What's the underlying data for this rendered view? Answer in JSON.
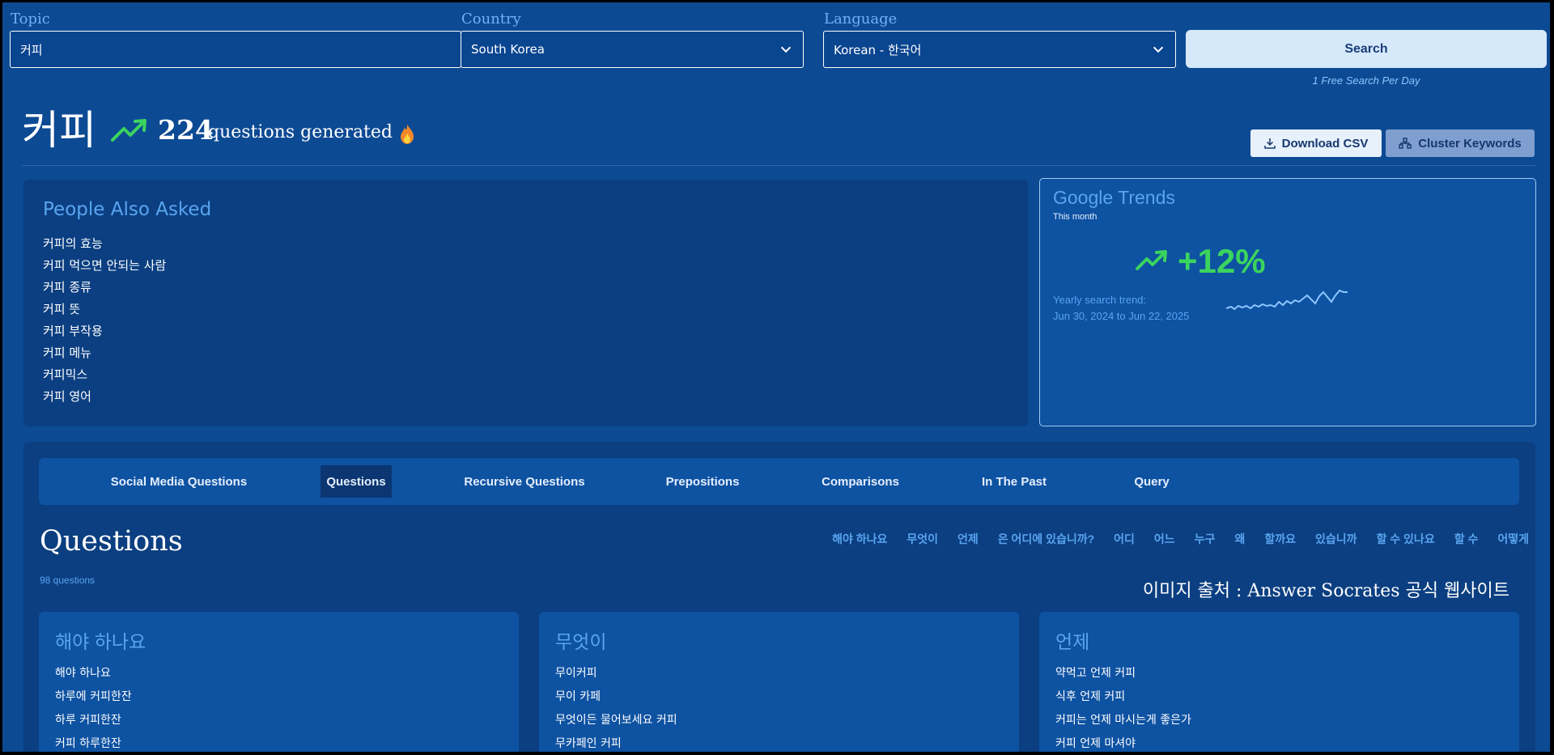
{
  "search": {
    "topic_label": "Topic",
    "topic_value": "커피",
    "country_label": "Country",
    "country_value": "South Korea",
    "language_label": "Language",
    "language_value": "Korean - 한국어",
    "search_button": "Search",
    "free_note": "1 Free Search Per Day"
  },
  "header": {
    "topic": "커피",
    "count": "224",
    "generated_text": "questions generated",
    "download_csv": "Download CSV",
    "cluster_keywords": "Cluster Keywords"
  },
  "paa": {
    "title": "People Also Asked",
    "items": [
      "커피의 효능",
      "커피 먹으면 안되는 사람",
      "커피 종류",
      "커피 뜻",
      "커피 부작용",
      "커피 메뉴",
      "커피믹스",
      "커피 영어"
    ]
  },
  "trends": {
    "title": "Google Trends",
    "subtitle": "This month",
    "percent": "+12%",
    "yearly_label": "Yearly search trend:",
    "range": "Jun 30, 2024 to Jun 22, 2025",
    "accent": "#3bd45e"
  },
  "tabs": [
    {
      "label": "Social Media Questions"
    },
    {
      "label": "Questions"
    },
    {
      "label": "Recursive Questions"
    },
    {
      "label": "Prepositions"
    },
    {
      "label": "Comparisons"
    },
    {
      "label": "In The Past"
    },
    {
      "label": "Query"
    }
  ],
  "questions": {
    "heading": "Questions",
    "count": "98 questions",
    "filters": [
      "해야 하나요",
      "무엇이",
      "언제",
      "은 어디에 있습니까?",
      "어디",
      "어느",
      "누구",
      "왜",
      "할까요",
      "있습니까",
      "할 수 있나요",
      "할 수",
      "어떻게"
    ],
    "caption": "이미지 출처 : Answer Socrates 공식 웹사이트",
    "cards": [
      {
        "title": "해야 하나요",
        "items": [
          "해야 하나요",
          "하루에 커피한잔",
          "하루 커피한잔",
          "커피 하루한잔"
        ]
      },
      {
        "title": "무엇이",
        "items": [
          "무이커피",
          "무이 카페",
          "무엇이든 물어보세요 커피",
          "무카페인 커피"
        ]
      },
      {
        "title": "언제",
        "items": [
          "약먹고 언제 커피",
          "식후 언제 커피",
          "커피는 언제 마시는게 좋은가",
          "커피 언제 마셔야"
        ]
      }
    ]
  }
}
